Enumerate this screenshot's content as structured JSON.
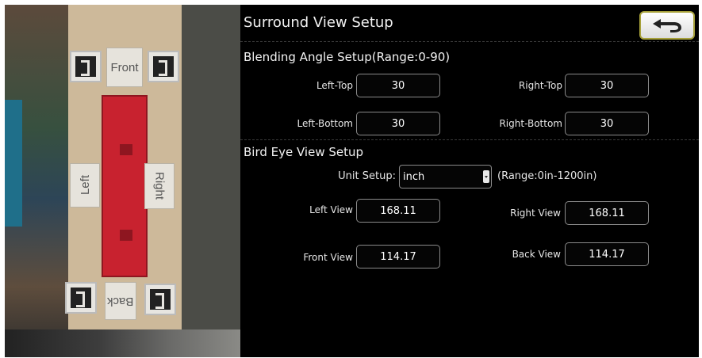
{
  "preview": {
    "labels": {
      "front": "Front",
      "back": "Back",
      "left": "Left",
      "right": "Right"
    }
  },
  "header": {
    "title": "Surround View Setup",
    "back_icon": "back-arrow-icon"
  },
  "blending": {
    "title": "Blending Angle Setup(Range:0-90)",
    "left_top": {
      "label": "Left-Top",
      "value": "30"
    },
    "right_top": {
      "label": "Right-Top",
      "value": "30"
    },
    "left_bottom": {
      "label": "Left-Bottom",
      "value": "30"
    },
    "right_bottom": {
      "label": "Right-Bottom",
      "value": "30"
    }
  },
  "bird_eye": {
    "title": "Bird Eye View Setup",
    "unit_label": "Unit Setup:",
    "unit_value": "inch",
    "range": "(Range:0in-1200in)",
    "left_view": {
      "label": "Left View",
      "value": "168.11"
    },
    "right_view": {
      "label": "Right View",
      "value": "168.11"
    },
    "front_view": {
      "label": "Front View",
      "value": "114.17"
    },
    "back_view": {
      "label": "Back View",
      "value": "114.17"
    }
  },
  "colors": {
    "panel_bg": "#000000",
    "back_button_border": "#a6a03a",
    "car_red": "#c8222f"
  }
}
